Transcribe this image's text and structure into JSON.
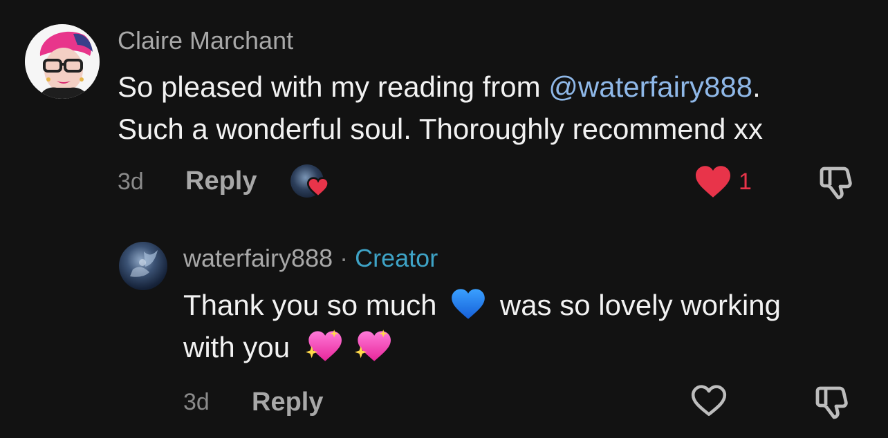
{
  "comment": {
    "author": "Claire Marchant",
    "text_line1_before": "So pleased with my reading from ",
    "mention": "@waterfairy888",
    "text_line1_after": ".",
    "text_line2": "Such a wonderful soul. Thoroughly recommend xx",
    "time": "3d",
    "reply_label": "Reply",
    "like_count": "1",
    "liked": true,
    "liked_by_creator": true
  },
  "reply": {
    "author": "waterfairy888",
    "separator": "·",
    "badge": "Creator",
    "text_line1_a": "Thank you so much",
    "emoji_blue_heart": "💙",
    "text_line1_b": "was so lovely working",
    "text_line2": "with you",
    "emoji_sparkle_hearts": "💖💖",
    "time": "3d",
    "reply_label": "Reply",
    "liked": false
  },
  "colors": {
    "background": "#121212",
    "like_red": "#e8344a",
    "mention_blue": "#8fb8e8",
    "creator_blue": "#3ea3c6"
  },
  "icons": [
    "heart-filled-icon",
    "heart-outline-icon",
    "thumbs-down-icon"
  ]
}
